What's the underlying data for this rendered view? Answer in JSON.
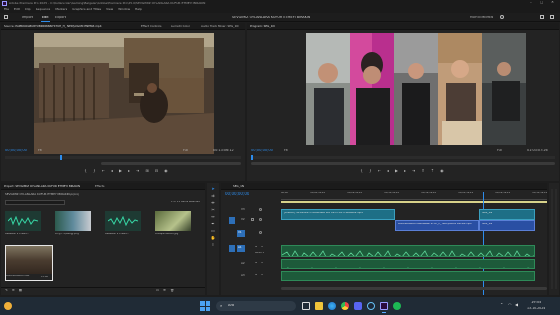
{
  "titlebar": {
    "title": "Adobe Premiere Pro 2025 - C:\\Kullanıcılar\\Gaming\\Belgeler\\Adobe\\Premiere Pro\\25.0\\SEVGİMİZ OYLANLARA KÜFÜR ETMEYİ BIRAKIN"
  },
  "menu": [
    "File",
    "Edit",
    "Clip",
    "Sequence",
    "Markers",
    "Graphics and Titles",
    "View",
    "Window",
    "Help"
  ],
  "workspace_tabs": {
    "import": "Import",
    "edit": "Edit",
    "export": "Export",
    "center_title": "SEVGİMİZ OYLANLARA KÜFÜR ETMEYİ BIRAKIN",
    "right_label": "MUHTEMEMEN"
  },
  "source_panel": {
    "tabs": [
      "Source: PAPRIKOGBURTUBRINNNNYSTUH_H_ NEDŞÜĞÜM ENEMZ.mp4",
      "Effect Controls",
      "Lumetri Color",
      "Audio Track Mixer: SEG_1N"
    ],
    "timecode_left": "00;00;00;00",
    "zoom": "Fit",
    "resolution": "Full",
    "timecode_right": "00:13:06:12"
  },
  "program_panel": {
    "title": "Program: SEG_1N",
    "timecode_left": "00;00;00;00",
    "zoom": "Fit",
    "resolution": "Full",
    "timecode_right": "01:03:07:26"
  },
  "project_panel": {
    "tabs": [
      "Project: SEVGİMİZ OYLANLARA KÜFÜR ETMEYİ BIRAKIN",
      "Effects"
    ],
    "path": "SEVGİMİZ OYLANLARA KÜFÜR ETMEYİ BIRAKIN.prproj",
    "count": "1 of 11 items selected",
    "items": [
      {
        "name": "Assassin's Creed...",
        "duration": "1:31"
      },
      {
        "name": "a7@FTQ6wtgJ.png",
        "duration": ""
      },
      {
        "name": "Assassin's Creed...",
        "duration": "1:31"
      },
      {
        "name": "Anlaşılmaktan.jpg",
        "duration": ""
      },
      {
        "name": "PAPRIKOGBURTUBR",
        "duration": "13:06"
      }
    ]
  },
  "timeline": {
    "title": "SEG_1N",
    "timecode": "00;00;00;00",
    "ruler": [
      "00;00",
      "00;04;59;29",
      "00;09;59;29",
      "00;14;59;29",
      "00;19;59;29",
      "00;24;59;29",
      "00;29;59;29",
      "00;34;59;29"
    ],
    "tracks_video": [
      "V3",
      "V2",
      "V1"
    ],
    "tracks_audio": [
      "A1",
      "A2",
      "A3"
    ],
    "clip_v2": "[DIKKAT] SEVGİMİZ OYLANLARA KÜFÜR ETMEYİ BIRAKIN.mp4",
    "clip_v2b": "SEG_1N",
    "clip_v1": "PAPRIKOGBURTUBRINNNNYSTUH_H_ NEDŞÜĞÜM ENEMZ.mp4",
    "clip_v1b": "SEG_1N",
    "audio_label": "Audio 1"
  },
  "taskbar": {
    "search_placeholder": "Ara",
    "time": "19:55",
    "date": "13.10.2024"
  }
}
